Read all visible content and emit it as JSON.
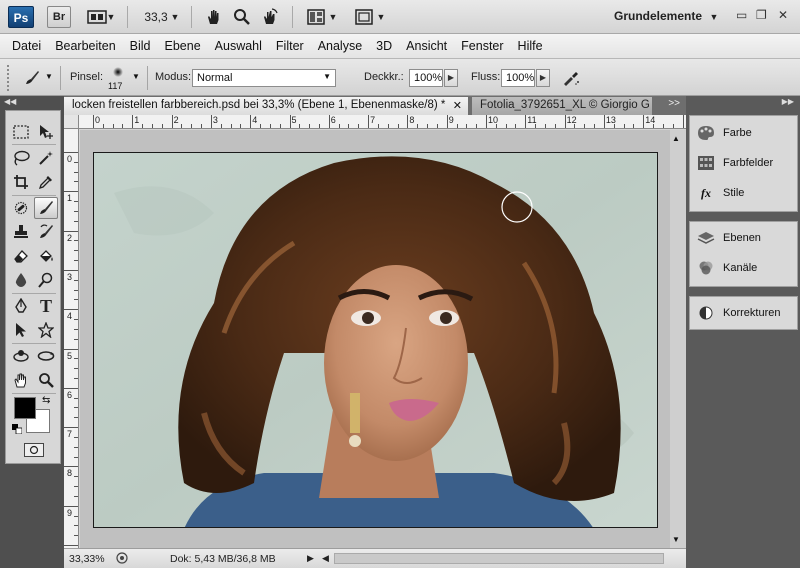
{
  "appbar": {
    "ps_logo": "Ps",
    "br_logo": "Br",
    "zoom": "33,3",
    "workspace": "Grundelemente"
  },
  "menu": [
    "Datei",
    "Bearbeiten",
    "Bild",
    "Ebene",
    "Auswahl",
    "Filter",
    "Analyse",
    "3D",
    "Ansicht",
    "Fenster",
    "Hilfe"
  ],
  "options": {
    "brush_label": "Pinsel:",
    "brush_size": "117",
    "mode_label": "Modus:",
    "mode_value": "Normal",
    "opacity_label": "Deckkr.:",
    "opacity_value": "100%",
    "flow_label": "Fluss:",
    "flow_value": "100%"
  },
  "tabs": {
    "active": "locken freistellen farbbereich.psd bei 33,3% (Ebene 1, Ebenenmaske/8) *",
    "inactive": "Fotolia_3792651_XL © Giorgio G"
  },
  "rulers": {
    "h": [
      "0",
      "1",
      "2",
      "3",
      "4",
      "5",
      "6",
      "7",
      "8",
      "9",
      "10",
      "11",
      "12",
      "13",
      "14"
    ],
    "v": [
      "0",
      "1",
      "2",
      "3",
      "4",
      "5",
      "6",
      "7",
      "8",
      "9"
    ]
  },
  "status": {
    "zoom": "33,33%",
    "doc": "Dok: 5,43 MB/36,8 MB"
  },
  "panels": {
    "group1": [
      "Farbe",
      "Farbfelder",
      "Stile"
    ],
    "group2": [
      "Ebenen",
      "Kanäle"
    ],
    "group3": [
      "Korrekturen"
    ]
  }
}
